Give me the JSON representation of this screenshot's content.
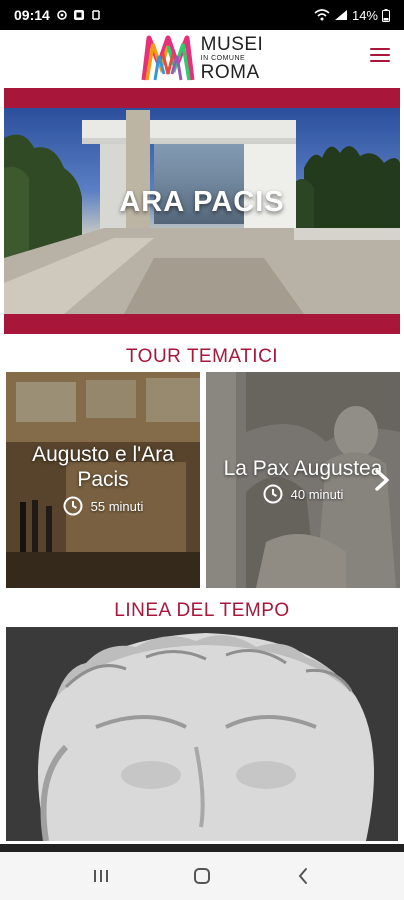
{
  "status_bar": {
    "time": "09:14",
    "battery": "14%",
    "notification_icons": [
      "gear-icon",
      "app-icon",
      "sync-icon"
    ]
  },
  "app": {
    "logo_line1": "MUSEI",
    "logo_line2": "IN COMUNE",
    "logo_line3": "ROMA",
    "menu_icon": "hamburger-icon"
  },
  "hero": {
    "title": "ARA PACIS"
  },
  "tours": {
    "section_title": "TOUR TEMATICI",
    "items": [
      {
        "title": "Augusto e l'Ara Pacis",
        "duration": "55 minuti"
      },
      {
        "title": "La Pax Augustea",
        "duration": "40 minuti"
      }
    ]
  },
  "timeline": {
    "section_title": "LINEA DEL TEMPO"
  },
  "colors": {
    "accent": "#a8163a"
  },
  "nav": {
    "icons": [
      "recents-icon",
      "home-icon",
      "back-icon"
    ]
  }
}
